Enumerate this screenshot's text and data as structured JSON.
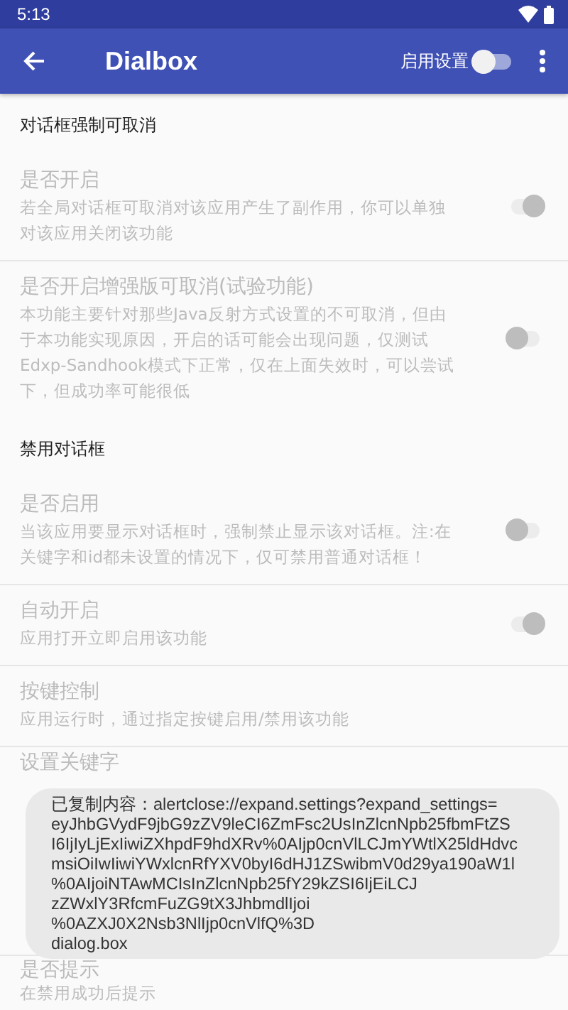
{
  "status_bar": {
    "time": "5:13"
  },
  "toolbar": {
    "title": "Dialbox",
    "switch_label": "启用设置",
    "switch_on": false
  },
  "sections": [
    {
      "header": "对话框强制可取消",
      "items": [
        {
          "title": "是否开启",
          "subtitle": "若全局对话框可取消对该应用产生了副作用，你可以单独对该应用关闭该功能",
          "kind": "toggle",
          "on": true
        },
        {
          "title": "是否开启增强版可取消(试验功能)",
          "subtitle": "本功能主要针对那些Java反射方式设置的不可取消，但由于本功能实现原因，开启的话可能会出现问题，仅测试Edxp-Sandhook模式下正常，仅在上面失效时，可以尝试下，但成功率可能很低",
          "kind": "toggle",
          "on": false
        }
      ]
    },
    {
      "header": "禁用对话框",
      "items": [
        {
          "title": "是否启用",
          "subtitle": "当该应用要显示对话框时，强制禁止显示该对话框。注:在关键字和id都未设置的情况下，仅可禁用普通对话框！",
          "kind": "toggle",
          "on": false
        },
        {
          "title": "自动开启",
          "subtitle": "应用打开立即启用该功能",
          "kind": "toggle",
          "on": true
        },
        {
          "title": "按键控制",
          "subtitle": "应用运行时，通过指定按键启用/禁用该功能",
          "kind": "plain"
        },
        {
          "title": "设置关键字",
          "kind": "covered"
        },
        {
          "title": "是否提示",
          "subtitle": "在禁用成功后提示",
          "kind": "plain"
        }
      ]
    }
  ],
  "toast": {
    "lines": [
      "已复制内容：alertclose://expand.settings?expand_settings=",
      "eyJhbGVydF9jbG9zZV9leCI6ZmFsc2UsInZlcnNpb25fbmFtZS",
      "I6IjIyLjExIiwiZXhpdF9hdXRv%0AIjp0cnVlLCJmYWtlX25ldHdvc",
      "msiOiIwIiwiYWxlcnRfYXV0byI6dHJ1ZSwibmV0d29ya190aW1l",
      "%0AIjoiNTAwMCIsInZlcnNpb25fY29kZSI6IjEiLCJ",
      "zZWxlY3RfcmFuZG9tX3JhbmdlIjoi",
      "%0AZXJ0X2Nsb3NlIjp0cnVlfQ%3D",
      "dialog.box"
    ]
  }
}
